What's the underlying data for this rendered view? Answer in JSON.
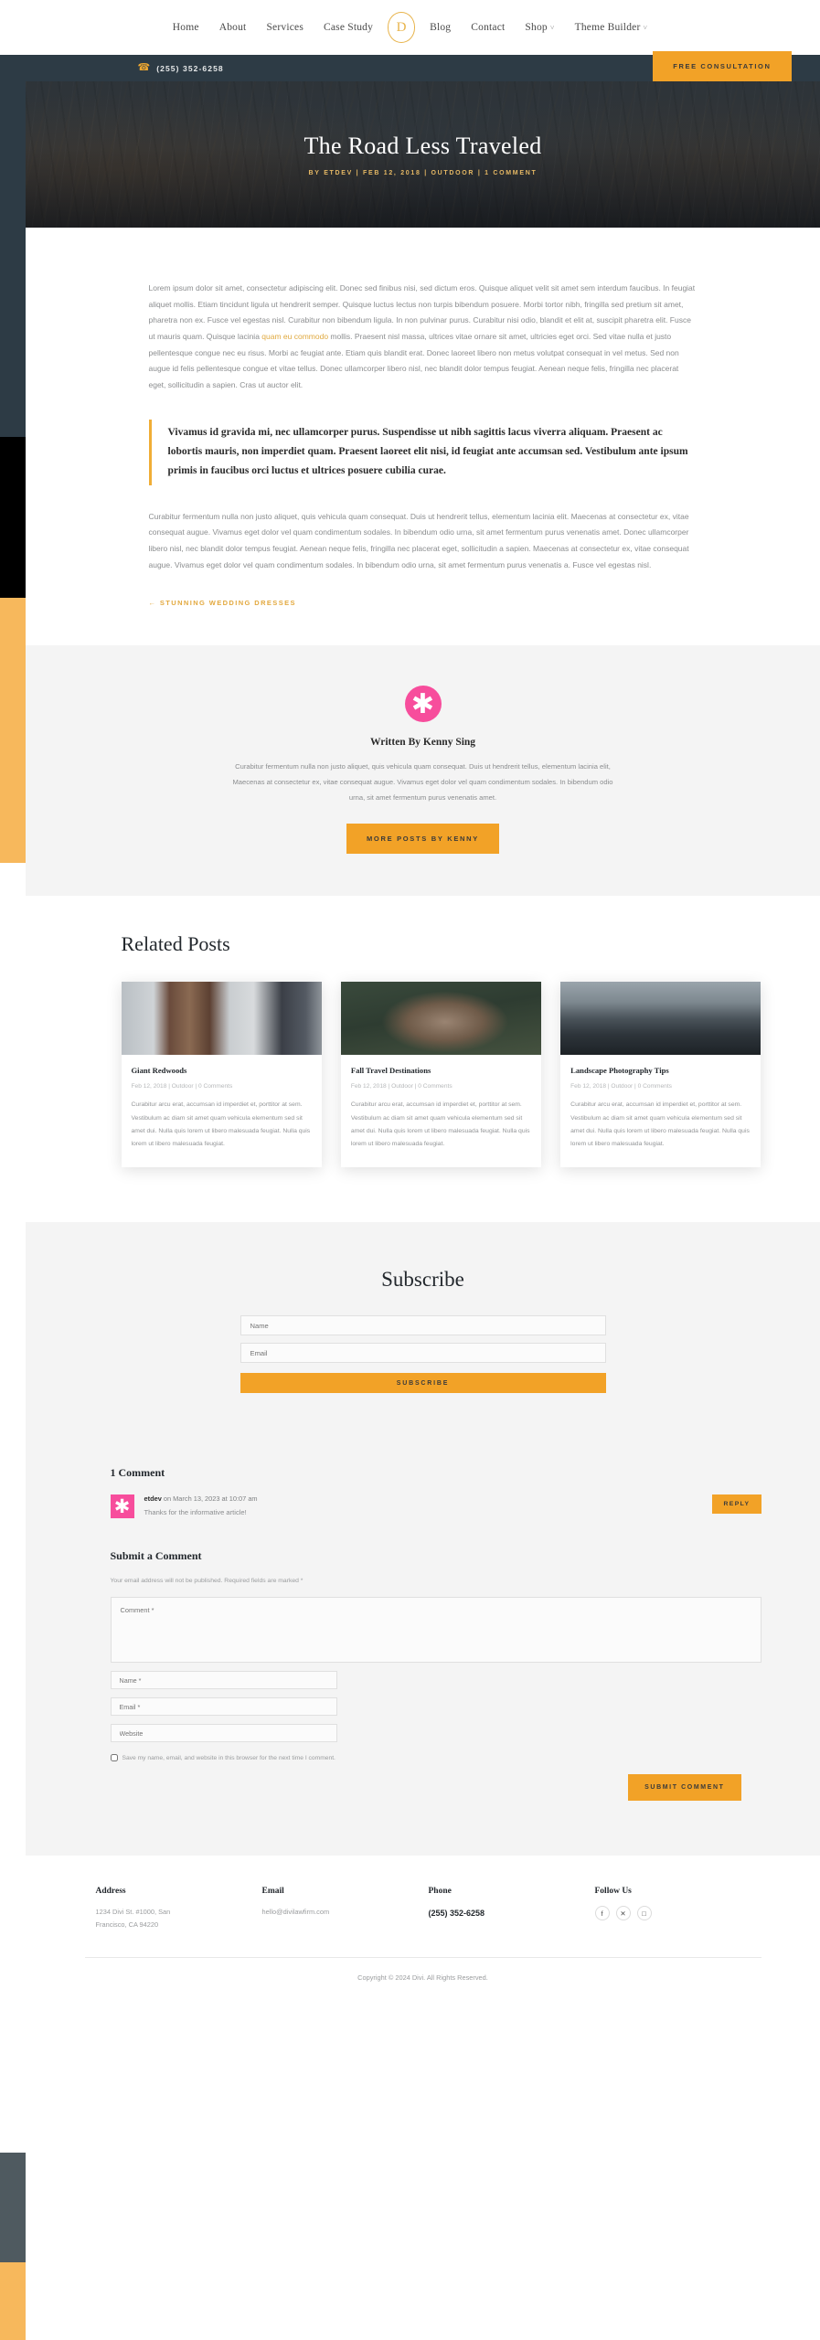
{
  "nav": {
    "items": [
      {
        "label": "Home",
        "caret": false
      },
      {
        "label": "About",
        "caret": false
      },
      {
        "label": "Services",
        "caret": false
      },
      {
        "label": "Case Study",
        "caret": false
      }
    ],
    "items_right": [
      {
        "label": "Blog",
        "caret": false
      },
      {
        "label": "Contact",
        "caret": false
      },
      {
        "label": "Shop",
        "caret": true
      },
      {
        "label": "Theme Builder",
        "caret": true
      }
    ],
    "logo_letter": "D",
    "caret_glyph": "˅"
  },
  "topbar": {
    "phone_icon": "☎",
    "phone": "(255) 352-6258",
    "cta_label": "FREE CONSULTATION"
  },
  "hero": {
    "title": "The Road Less Traveled",
    "meta": "BY ETDEV  |  FEB 12, 2018  |  OUTDOOR  |  1 COMMENT"
  },
  "article": {
    "paragraph1_a": "Lorem ipsum dolor sit amet, consectetur adipiscing elit. Donec sed finibus nisi, sed dictum eros. Quisque aliquet velit sit amet sem interdum faucibus. In feugiat aliquet mollis. Etiam tincidunt ligula ut hendrerit semper. Quisque luctus lectus non turpis bibendum posuere. Morbi tortor nibh, fringilla sed pretium sit amet, pharetra non ex. Fusce vel egestas nisl. Curabitur non bibendum ligula. In non pulvinar purus. Curabitur nisi odio, blandit et elit at, suscipit pharetra elit. Fusce ut mauris quam. Quisque lacinia ",
    "paragraph1_link": "quam eu commodo",
    "paragraph1_b": " mollis. Praesent nisl massa, ultrices vitae ornare sit amet, ultricies eget orci. Sed vitae nulla et justo pellentesque congue nec eu risus. Morbi ac feugiat ante. Etiam quis blandit erat. Donec laoreet libero non metus volutpat consequat in vel metus. Sed non augue id felis pellentesque congue et vitae tellus. Donec ullamcorper libero nisl, nec blandit dolor tempus feugiat. Aenean neque felis, fringilla nec placerat eget, sollicitudin a sapien. Cras ut auctor elit.",
    "blockquote": "Vivamus id gravida mi, nec ullamcorper purus. Suspendisse ut nibh sagittis lacus viverra aliquam. Praesent ac lobortis mauris, non imperdiet quam. Praesent laoreet elit nisi, id feugiat ante accumsan sed. Vestibulum ante ipsum primis in faucibus orci luctus et ultrices posuere cubilia curae.",
    "paragraph2": "Curabitur fermentum nulla non justo aliquet, quis vehicula quam consequat. Duis ut hendrerit tellus, elementum lacinia elit. Maecenas at consectetur ex, vitae consequat augue. Vivamus eget dolor vel quam condimentum sodales. In bibendum odio urna, sit amet fermentum purus venenatis amet. Donec ullamcorper libero nisl, nec blandit dolor tempus feugiat. Aenean neque felis, fringilla nec placerat eget, sollicitudin a sapien. Maecenas at consectetur ex, vitae consequat augue. Vivamus eget dolor vel quam condimentum sodales. In bibendum odio urna, sit amet fermentum purus venenatis a. Fusce vel egestas nisl.",
    "prev_link": "←  STUNNING WEDDING DRESSES"
  },
  "author": {
    "avatar_icon": "asterisk-icon",
    "avatar_glyph": "✱",
    "name": "Written By Kenny Sing",
    "bio": "Curabitur fermentum nulla non justo aliquet, quis vehicula quam consequat. Duis ut hendrerit tellus, elementum lacinia elit, Maecenas at consectetur ex, vitae consequat augue. Vivamus eget dolor vel quam condimentum sodales. In bibendum odio urna, sit amet fermentum purus venenatis amet.",
    "button_label": "MORE POSTS BY KENNY"
  },
  "related": {
    "heading": "Related Posts",
    "cards": [
      {
        "title": "Giant Redwoods",
        "meta": "Feb 12, 2018 | Outdoor | 0 Comments",
        "excerpt": "Curabitur arcu erat, accumsan id imperdiet et, porttitor at sem. Vestibulum ac diam sit amet quam vehicula elementum sed sit amet dui. Nulla quis lorem ut libero malesuada feugiat. Nulla quis lorem ut libero malesuada feugiat.",
        "image": "redwood-forest-image"
      },
      {
        "title": "Fall Travel Destinations",
        "meta": "Feb 12, 2018 | Outdoor | 0 Comments",
        "excerpt": "Curabitur arcu erat, accumsan id imperdiet et, porttitor at sem. Vestibulum ac diam sit amet quam vehicula elementum sed sit amet dui. Nulla quis lorem ut libero malesuada feugiat. Nulla quis lorem ut libero malesuada feugiat.",
        "image": "pinecone-image"
      },
      {
        "title": "Landscape Photography Tips",
        "meta": "Feb 12, 2018 | Outdoor | 0 Comments",
        "excerpt": "Curabitur arcu erat, accumsan id imperdiet et, porttitor at sem. Vestibulum ac diam sit amet quam vehicula elementum sed sit amet dui. Nulla quis lorem ut libero malesuada feugiat. Nulla quis lorem ut libero malesuada feugiat.",
        "image": "mountain-landscape-image"
      }
    ]
  },
  "subscribe": {
    "heading": "Subscribe",
    "name_placeholder": "Name",
    "email_placeholder": "Email",
    "button_label": "SUBSCRIBE"
  },
  "comments": {
    "count_heading": "1 Comment",
    "author": "etdev",
    "meta_rest": " on March 13, 2023 at 10:07 am",
    "text": "Thanks for the informative article!",
    "reply_label": "REPLY",
    "avatar_glyph": "✱",
    "form_heading": "Submit a Comment",
    "form_note": "Your email address will not be published. Required fields are marked *",
    "comment_placeholder": "Comment *",
    "name_placeholder": "Name *",
    "email_placeholder": "Email *",
    "website_placeholder": "Website",
    "cookie_label": "Save my name, email, and website in this browser for the next time I comment.",
    "submit_label": "SUBMIT COMMENT"
  },
  "footer": {
    "columns": [
      {
        "heading": "Address",
        "line1": "1234 Divi St. #1000, San",
        "line2": "Francisco, CA 94220"
      },
      {
        "heading": "Email",
        "line1": "hello@divilawfirm.com",
        "line2": ""
      },
      {
        "heading": "Phone",
        "line1": "(255) 352-6258",
        "line2": ""
      },
      {
        "heading": "Follow Us",
        "line1": "",
        "line2": ""
      }
    ],
    "socials": [
      {
        "name": "facebook-icon",
        "glyph": "f"
      },
      {
        "name": "x-twitter-icon",
        "glyph": "✕"
      },
      {
        "name": "instagram-icon",
        "glyph": "□"
      }
    ],
    "copyright": "Copyright © 2024 Divi. All Rights Reserved."
  },
  "colors": {
    "accent_amber": "#f2a227",
    "dark_navy": "#2d3b45",
    "pink": "#f74d9c",
    "light_grey": "#f4f4f4"
  }
}
